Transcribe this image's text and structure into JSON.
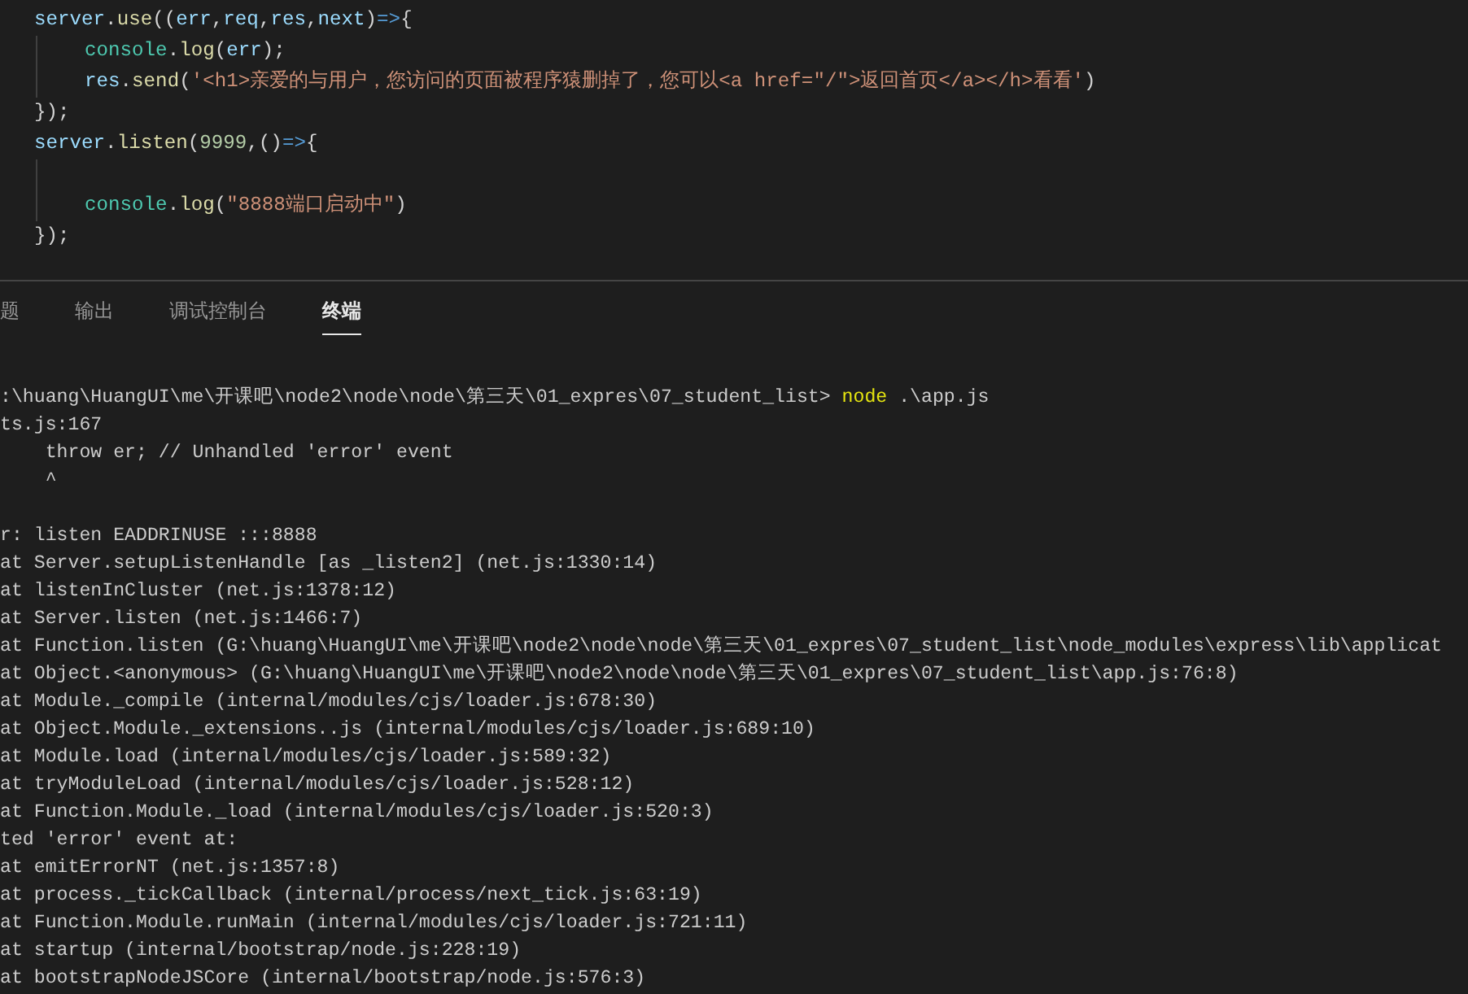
{
  "editor": {
    "lines": [
      {
        "tokens": [
          {
            "text": "server",
            "kind": "variable"
          },
          {
            "text": ".",
            "kind": "punct"
          },
          {
            "text": "use",
            "kind": "function"
          },
          {
            "text": "((",
            "kind": "punct"
          },
          {
            "text": "err",
            "kind": "variable"
          },
          {
            "text": ",",
            "kind": "punct"
          },
          {
            "text": "req",
            "kind": "variable"
          },
          {
            "text": ",",
            "kind": "punct"
          },
          {
            "text": "res",
            "kind": "variable"
          },
          {
            "text": ",",
            "kind": "punct"
          },
          {
            "text": "next",
            "kind": "variable"
          },
          {
            "text": ")",
            "kind": "punct"
          },
          {
            "text": "=>",
            "kind": "keyword"
          },
          {
            "text": "{",
            "kind": "punct"
          }
        ]
      },
      {
        "indented": true,
        "tokens": [
          {
            "text": "console",
            "kind": "class"
          },
          {
            "text": ".",
            "kind": "punct"
          },
          {
            "text": "log",
            "kind": "function"
          },
          {
            "text": "(",
            "kind": "punct"
          },
          {
            "text": "err",
            "kind": "variable"
          },
          {
            "text": ");",
            "kind": "punct"
          }
        ]
      },
      {
        "indented": true,
        "tokens": [
          {
            "text": "res",
            "kind": "variable"
          },
          {
            "text": ".",
            "kind": "punct"
          },
          {
            "text": "send",
            "kind": "function"
          },
          {
            "text": "(",
            "kind": "punct"
          },
          {
            "text": "'<h1>亲爱的与用户，您访问的页面被程序猿删掉了，您可以<a href=\"/\">返回首页</a></h>看看'",
            "kind": "string"
          },
          {
            "text": ")",
            "kind": "punct"
          }
        ]
      },
      {
        "tokens": [
          {
            "text": "});",
            "kind": "punct"
          }
        ]
      },
      {
        "tokens": [
          {
            "text": "server",
            "kind": "variable"
          },
          {
            "text": ".",
            "kind": "punct"
          },
          {
            "text": "listen",
            "kind": "function"
          },
          {
            "text": "(",
            "kind": "punct"
          },
          {
            "text": "9999",
            "kind": "number"
          },
          {
            "text": ",()",
            "kind": "punct"
          },
          {
            "text": "=>",
            "kind": "keyword"
          },
          {
            "text": "{",
            "kind": "punct"
          }
        ]
      },
      {
        "indented": true
      },
      {
        "indented": true,
        "tokens": [
          {
            "text": "console",
            "kind": "class"
          },
          {
            "text": ".",
            "kind": "punct"
          },
          {
            "text": "log",
            "kind": "function"
          },
          {
            "text": "(",
            "kind": "punct"
          },
          {
            "text": "\"8888端口启动中\"",
            "kind": "string"
          },
          {
            "text": ")",
            "kind": "punct"
          }
        ]
      },
      {
        "tokens": [
          {
            "text": "});",
            "kind": "punct"
          }
        ]
      }
    ]
  },
  "panel_tabs": [
    {
      "label": "题",
      "selected": false
    },
    {
      "label": "输出",
      "selected": false
    },
    {
      "label": "调试控制台",
      "selected": false
    },
    {
      "label": "终端",
      "selected": true
    }
  ],
  "terminal": {
    "lines": [
      {
        "tokens": [
          {
            "text": ":\\huang\\HuangUI\\me\\开课吧\\node2\\node\\node\\第三天\\01_expres\\07_student_list> ",
            "kind": "output"
          },
          {
            "text": "node",
            "kind": "command"
          },
          {
            "text": " .\\app.js",
            "kind": "output"
          }
        ]
      },
      {
        "tokens": [
          {
            "text": "ts.js:167",
            "kind": "output"
          }
        ]
      },
      {
        "tokens": [
          {
            "text": "    throw er; // Unhandled 'error' event",
            "kind": "output"
          }
        ]
      },
      {
        "tokens": [
          {
            "text": "    ^",
            "kind": "output"
          }
        ]
      },
      {
        "gap_before": true,
        "tokens": [
          {
            "text": "r: listen EADDRINUSE :::8888",
            "kind": "output"
          }
        ]
      },
      {
        "tokens": [
          {
            "text": "at Server.setupListenHandle [as _listen2] (net.js:1330:14)",
            "kind": "output"
          }
        ]
      },
      {
        "tokens": [
          {
            "text": "at listenInCluster (net.js:1378:12)",
            "kind": "output"
          }
        ]
      },
      {
        "tokens": [
          {
            "text": "at Server.listen (net.js:1466:7)",
            "kind": "output"
          }
        ]
      },
      {
        "tokens": [
          {
            "text": "at Function.listen (G:\\huang\\HuangUI\\me\\开课吧\\node2\\node\\node\\第三天\\01_expres\\07_student_list\\node_modules\\express\\lib\\applicat",
            "kind": "output"
          }
        ]
      },
      {
        "tokens": [
          {
            "text": "at Object.<anonymous> (G:\\huang\\HuangUI\\me\\开课吧\\node2\\node\\node\\第三天\\01_expres\\07_student_list\\app.js:76:8)",
            "kind": "output"
          }
        ]
      },
      {
        "tokens": [
          {
            "text": "at Module._compile (internal/modules/cjs/loader.js:678:30)",
            "kind": "output"
          }
        ]
      },
      {
        "tokens": [
          {
            "text": "at Object.Module._extensions..js (internal/modules/cjs/loader.js:689:10)",
            "kind": "output"
          }
        ]
      },
      {
        "tokens": [
          {
            "text": "at Module.load (internal/modules/cjs/loader.js:589:32)",
            "kind": "output"
          }
        ]
      },
      {
        "tokens": [
          {
            "text": "at tryModuleLoad (internal/modules/cjs/loader.js:528:12)",
            "kind": "output"
          }
        ]
      },
      {
        "tokens": [
          {
            "text": "at Function.Module._load (internal/modules/cjs/loader.js:520:3)",
            "kind": "output"
          }
        ]
      },
      {
        "tokens": [
          {
            "text": "ted 'error' event at:",
            "kind": "output"
          }
        ]
      },
      {
        "tokens": [
          {
            "text": "at emitErrorNT (net.js:1357:8)",
            "kind": "output"
          }
        ]
      },
      {
        "tokens": [
          {
            "text": "at process._tickCallback (internal/process/next_tick.js:63:19)",
            "kind": "output"
          }
        ]
      },
      {
        "tokens": [
          {
            "text": "at Function.Module.runMain (internal/modules/cjs/loader.js:721:11)",
            "kind": "output"
          }
        ]
      },
      {
        "tokens": [
          {
            "text": "at startup (internal/bootstrap/node.js:228:19)",
            "kind": "output"
          }
        ]
      },
      {
        "tokens": [
          {
            "text": "at bootstrapNodeJSCore (internal/bootstrap/node.js:576:3)",
            "kind": "output"
          }
        ]
      }
    ]
  }
}
